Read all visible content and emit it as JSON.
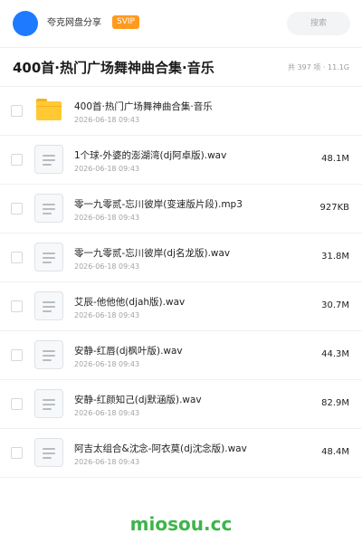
{
  "header": {
    "app_name": "夸克网盘分享",
    "badge": "SVIP",
    "search_label": "搜索",
    "avatar_color": "#1e7bff"
  },
  "title_bar": {
    "title": "400首·热门广场舞神曲合集·音乐",
    "meta": "共 397 项 · 11.1G"
  },
  "files": [
    {
      "type": "folder",
      "icon": "folder-icon",
      "name": "400首·热门广场舞神曲合集·音乐",
      "date": "2026-06-18 09:43",
      "size": ""
    },
    {
      "type": "file",
      "icon": "document-icon",
      "name": "1个球-外婆的澎湖湾(dj阿卓版).wav",
      "date": "2026-06-18 09:43",
      "size": "48.1M"
    },
    {
      "type": "file",
      "icon": "document-icon",
      "name": "零一九零贰-忘川彼岸(变速版片段).mp3",
      "date": "2026-06-18 09:43",
      "size": "927KB"
    },
    {
      "type": "file",
      "icon": "document-icon",
      "name": "零一九零贰-忘川彼岸(dj名龙版).wav",
      "date": "2026-06-18 09:43",
      "size": "31.8M"
    },
    {
      "type": "file",
      "icon": "document-icon",
      "name": "艾辰-他他他(djah版).wav",
      "date": "2026-06-18 09:43",
      "size": "30.7M"
    },
    {
      "type": "file",
      "icon": "document-icon",
      "name": "安静-红唇(dj枫叶版).wav",
      "date": "2026-06-18 09:43",
      "size": "44.3M"
    },
    {
      "type": "file",
      "icon": "document-icon",
      "name": "安静-红颜知己(dj默涵版).wav",
      "date": "2026-06-18 09:43",
      "size": "82.9M"
    },
    {
      "type": "file",
      "icon": "document-icon",
      "name": "阿吉太组合&沈念-阿衣莫(dj沈念版).wav",
      "date": "2026-06-18 09:43",
      "size": "48.4M"
    }
  ],
  "watermark": "miosou.cc",
  "colors": {
    "badge": "#ff9a1f",
    "folder": "#ffc933",
    "watermark": "#3db54a"
  }
}
